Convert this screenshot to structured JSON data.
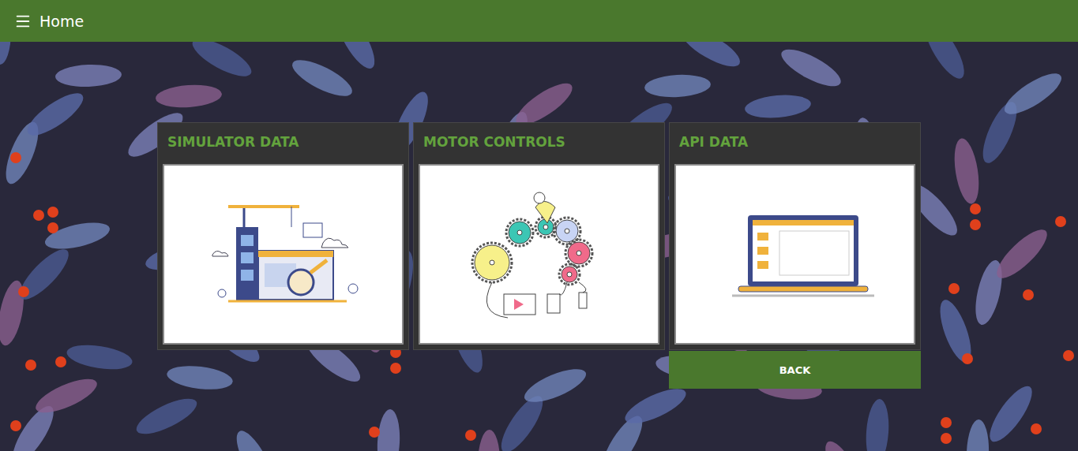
{
  "app_bar": {
    "title": "Home"
  },
  "cards": [
    {
      "title": "SIMULATOR DATA",
      "kind": "construction"
    },
    {
      "title": "MOTOR CONTROLS",
      "kind": "gears"
    },
    {
      "title": "API DATA",
      "kind": "laptop"
    }
  ],
  "buttons": [
    "BACK"
  ]
}
